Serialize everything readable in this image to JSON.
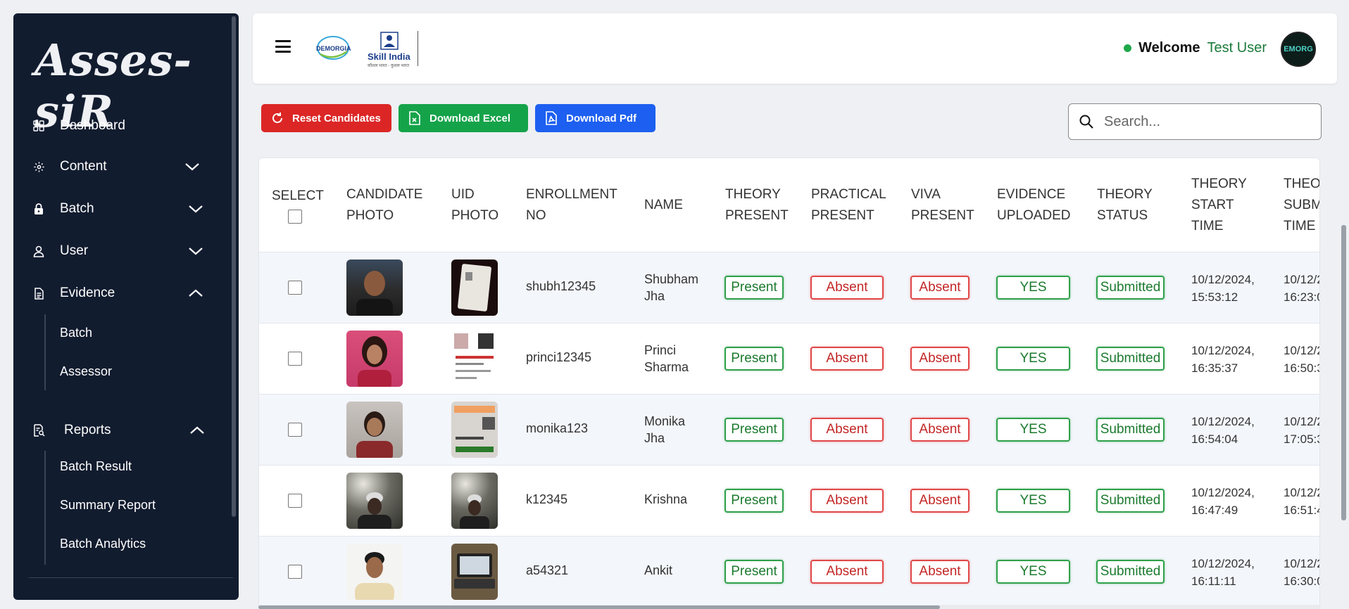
{
  "app": {
    "logo_text": "Asses-siR"
  },
  "sidebar": {
    "items": [
      {
        "label": "Dashboard",
        "icon": "grid-icon"
      },
      {
        "label": "Content",
        "icon": "gear-icon",
        "expanded": false
      },
      {
        "label": "Batch",
        "icon": "lock-icon",
        "expanded": false
      },
      {
        "label": "User",
        "icon": "user-icon",
        "expanded": false
      },
      {
        "label": "Evidence",
        "icon": "document-icon",
        "expanded": true
      },
      {
        "label": "Reports",
        "icon": "report-search-icon",
        "expanded": true
      }
    ],
    "evidence_sub": [
      "Batch",
      "Assessor"
    ],
    "reports_sub": [
      "Batch Result",
      "Summary Report",
      "Batch Analytics"
    ]
  },
  "header": {
    "logo1_text": "DEMORGIA",
    "logo2_text": "Skill India",
    "logo2_sub": "कौशल भारत - कुशल भारत",
    "welcome": "Welcome",
    "user_name": "Test User",
    "avatar_text": "EMORG",
    "status_color": "#1fa84a"
  },
  "actions": {
    "reset": "Reset Candidates",
    "excel": "Download Excel",
    "pdf": "Download Pdf"
  },
  "search": {
    "placeholder": "Search..."
  },
  "table": {
    "headers": {
      "select": "SELECT",
      "candidate_photo": [
        "CANDIDATE",
        "PHOTO"
      ],
      "uid_photo": [
        "UID",
        "PHOTO"
      ],
      "enrollment": [
        "ENROLLMENT",
        "NO"
      ],
      "name": "NAME",
      "theory_present": [
        "THEORY",
        "PRESENT"
      ],
      "practical_present": [
        "PRACTICAL",
        "PRESENT"
      ],
      "viva_present": [
        "VIVA",
        "PRESENT"
      ],
      "evidence": [
        "EVIDENCE",
        "UPLOADED"
      ],
      "theory_status": [
        "THEORY",
        "STATUS"
      ],
      "start_time": [
        "THEORY",
        "START",
        "TIME"
      ],
      "submit_time": [
        "THEO",
        "SUBM",
        "TIME"
      ]
    },
    "rows": [
      {
        "enrollment": "shubh12345",
        "name": [
          "Shubham",
          "Jha"
        ],
        "theory": "Present",
        "practical": "Absent",
        "viva": "Absent",
        "evidence": "YES",
        "status": "Submitted",
        "start": [
          "10/12/2024,",
          "15:53:12"
        ],
        "submit": [
          "10/12/2",
          "16:23:0"
        ]
      },
      {
        "enrollment": "princi12345",
        "name": [
          "Princi",
          "Sharma"
        ],
        "theory": "Present",
        "practical": "Absent",
        "viva": "Absent",
        "evidence": "YES",
        "status": "Submitted",
        "start": [
          "10/12/2024,",
          "16:35:37"
        ],
        "submit": [
          "10/12/2",
          "16:50:3"
        ]
      },
      {
        "enrollment": "monika123",
        "name": [
          "Monika",
          "Jha"
        ],
        "theory": "Present",
        "practical": "Absent",
        "viva": "Absent",
        "evidence": "YES",
        "status": "Submitted",
        "start": [
          "10/12/2024,",
          "16:54:04"
        ],
        "submit": [
          "10/12/2",
          "17:05:3"
        ]
      },
      {
        "enrollment": "k12345",
        "name": [
          "Krishna",
          ""
        ],
        "theory": "Present",
        "practical": "Absent",
        "viva": "Absent",
        "evidence": "YES",
        "status": "Submitted",
        "start": [
          "10/12/2024,",
          "16:47:49"
        ],
        "submit": [
          "10/12/2",
          "16:51:4"
        ]
      },
      {
        "enrollment": "a54321",
        "name": [
          "Ankit",
          ""
        ],
        "theory": "Present",
        "practical": "Absent",
        "viva": "Absent",
        "evidence": "YES",
        "status": "Submitted",
        "start": [
          "10/12/2024,",
          "16:11:11"
        ],
        "submit": [
          "10/12/2",
          "16:30:0"
        ]
      }
    ]
  },
  "colors": {
    "sidebar_bg": "#121c2f",
    "present": "#2fa04a",
    "absent": "#e04848",
    "reset": "#dc2626",
    "excel": "#15a34a",
    "pdf": "#1d5ff0"
  }
}
